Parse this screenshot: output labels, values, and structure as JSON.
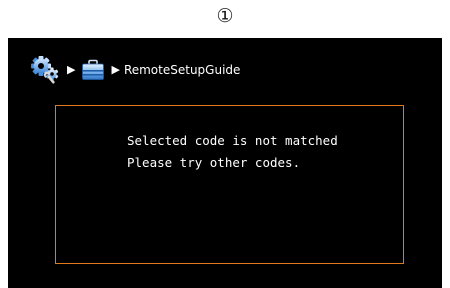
{
  "step_marker": "①",
  "breadcrumb": {
    "items": [
      {
        "icon": "setup-gear-icon"
      },
      {
        "icon": "toolbox-icon"
      }
    ],
    "separator_icon": "right-triangle-arrow-icon",
    "current_label": "RemoteSetupGuide"
  },
  "dialog": {
    "line1": "Selected code is not matched",
    "line2": "Please try other codes."
  },
  "colors": {
    "screen_background": "#000000",
    "dialog_border": "#e07a1f",
    "text": "#ffffff"
  }
}
